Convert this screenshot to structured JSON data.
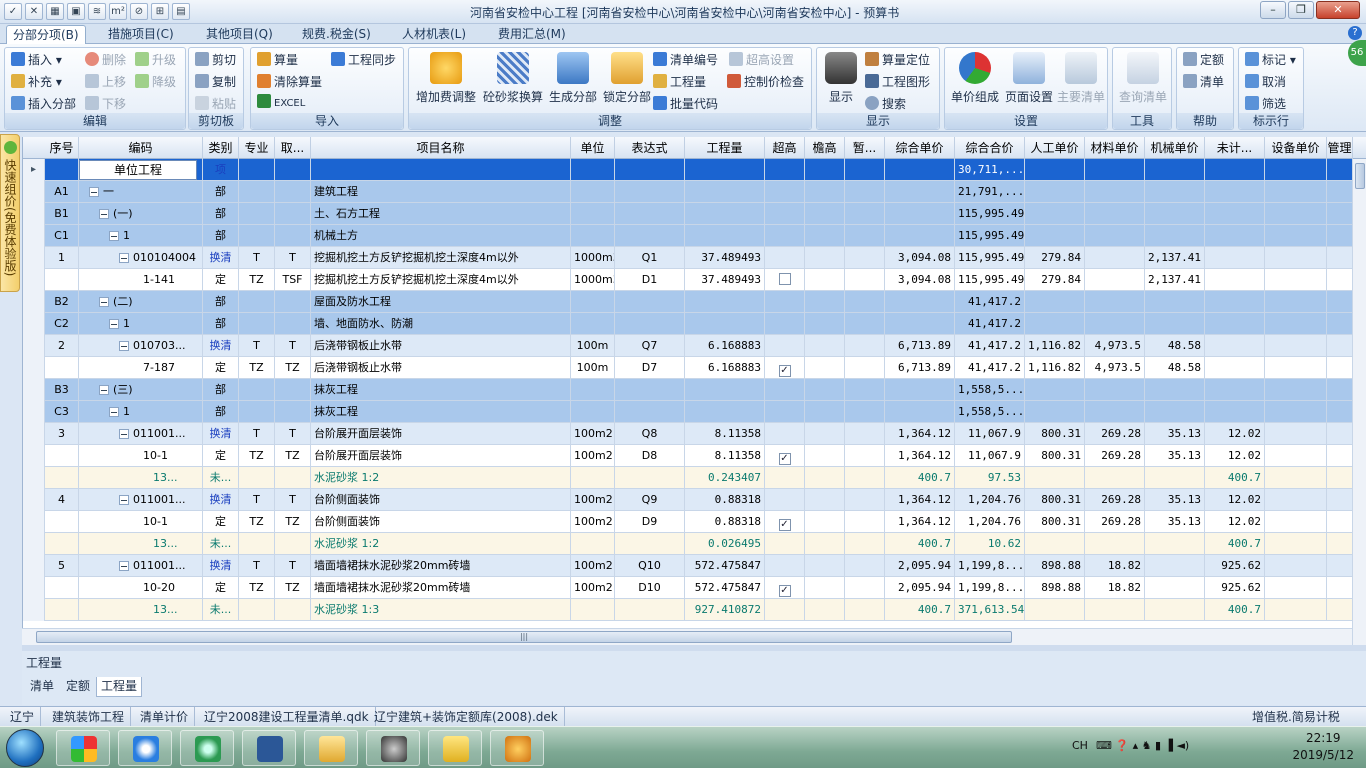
{
  "window": {
    "title": "河南省安检中心工程 [河南省安检中心\\河南省安检中心\\河南省安检中心] - 预算书"
  },
  "quick_access": [
    "✓",
    "✕",
    "▦",
    "▣",
    "≋",
    "m²",
    "⊘",
    "⊞",
    "▤"
  ],
  "tabs": [
    {
      "label": "分部分项(B)",
      "active": true
    },
    {
      "label": "措施项目(C)"
    },
    {
      "label": "其他项目(Q)"
    },
    {
      "label": "规费.税金(S)"
    },
    {
      "label": "人材机表(L)"
    },
    {
      "label": "费用汇总(M)"
    }
  ],
  "ribbon": {
    "groups": [
      {
        "name": "编辑",
        "small": [
          "插入",
          "删除",
          "升级",
          "补充",
          "上移",
          "降级",
          "插入分部",
          "下移"
        ]
      },
      {
        "name": "剪切板",
        "small": [
          "剪切",
          "复制",
          "粘贴"
        ]
      },
      {
        "name": "导入",
        "small": [
          "算量",
          "工程同步",
          "清除算量",
          "EXCEL"
        ]
      },
      {
        "name": "调整",
        "large": [
          "增加费调整",
          "砼砂浆换算",
          "生成分部",
          "锁定分部"
        ],
        "small": [
          "清单编号",
          "超高设置",
          "工程量",
          "控制价检查",
          "批量代码"
        ]
      },
      {
        "name": "显示",
        "large": [
          "显示"
        ],
        "small": [
          "算量定位",
          "工程图形",
          "搜索"
        ]
      },
      {
        "name": "设置",
        "large": [
          "单价组成",
          "页面设置",
          "主要清单"
        ]
      },
      {
        "name": "工具",
        "large": [
          "查询清单"
        ]
      },
      {
        "name": "帮助",
        "small": [
          "定额",
          "清单"
        ]
      },
      {
        "name": "标示行",
        "small": [
          "标记",
          "取消",
          "筛选"
        ]
      }
    ]
  },
  "side_tab": "快速组价(免费体验版)",
  "badge": "56",
  "columns": [
    "序号",
    "编码",
    "类别",
    "专业",
    "取...",
    "项目名称",
    "单位",
    "表达式",
    "工程量",
    "超高",
    "檐高",
    "暂...",
    "综合单价",
    "综合合价",
    "人工单价",
    "材料单价",
    "机械单价",
    "未计...",
    "设备单价",
    "管理"
  ],
  "rows": [
    {
      "type": "sel",
      "seq": "",
      "code": "单位工程",
      "cat": "项",
      "spec": "",
      "take": "",
      "name": "",
      "unit": "",
      "expr": "",
      "qty": "",
      "chk": "",
      "price": "",
      "total": "30,711,...",
      "labor": "",
      "mat": "",
      "mach": "",
      "unc": "",
      "level": 0
    },
    {
      "type": "blue",
      "seq": "A1",
      "code": "一",
      "cat": "部",
      "spec": "",
      "take": "",
      "name": "建筑工程",
      "unit": "",
      "expr": "",
      "qty": "",
      "chk": "",
      "price": "",
      "total": "21,791,...",
      "labor": "",
      "mat": "",
      "mach": "",
      "unc": "",
      "level": 1
    },
    {
      "type": "blue",
      "seq": "B1",
      "code": "(一)",
      "cat": "部",
      "spec": "",
      "take": "",
      "name": "土、石方工程",
      "unit": "",
      "expr": "",
      "qty": "",
      "chk": "",
      "price": "",
      "total": "115,995.49",
      "labor": "",
      "mat": "",
      "mach": "",
      "unc": "",
      "level": 2
    },
    {
      "type": "blue",
      "seq": "C1",
      "code": "1",
      "cat": "部",
      "spec": "",
      "take": "",
      "name": "机械土方",
      "unit": "",
      "expr": "",
      "qty": "",
      "chk": "",
      "price": "",
      "total": "115,995.49",
      "labor": "",
      "mat": "",
      "mach": "",
      "unc": "",
      "level": 3
    },
    {
      "type": "light",
      "seq": "1",
      "code": "010104004",
      "cat": "换清",
      "spec": "T",
      "take": "T",
      "name": "挖掘机挖土方反铲挖掘机挖土深度4m以外",
      "unit": "1000m3",
      "expr": "Q1",
      "qty": "37.489493",
      "chk": "",
      "price": "3,094.08",
      "total": "115,995.49",
      "labor": "279.84",
      "mat": "",
      "mach": "2,137.41",
      "unc": "",
      "level": 4
    },
    {
      "type": "white",
      "seq": "",
      "code": "1-141",
      "cat": "定",
      "spec": "TZ",
      "take": "TSF",
      "name": "挖掘机挖土方反铲挖掘机挖土深度4m以外",
      "unit": "1000m3",
      "expr": "D1",
      "qty": "37.489493",
      "chk": "☐",
      "price": "3,094.08",
      "total": "115,995.49",
      "labor": "279.84",
      "mat": "",
      "mach": "2,137.41",
      "unc": "",
      "level": 5
    },
    {
      "type": "blue",
      "seq": "B2",
      "code": "(二)",
      "cat": "部",
      "spec": "",
      "take": "",
      "name": "屋面及防水工程",
      "unit": "",
      "expr": "",
      "qty": "",
      "chk": "",
      "price": "",
      "total": "41,417.2",
      "labor": "",
      "mat": "",
      "mach": "",
      "unc": "",
      "level": 2
    },
    {
      "type": "blue",
      "seq": "C2",
      "code": "1",
      "cat": "部",
      "spec": "",
      "take": "",
      "name": "墙、地面防水、防潮",
      "unit": "",
      "expr": "",
      "qty": "",
      "chk": "",
      "price": "",
      "total": "41,417.2",
      "labor": "",
      "mat": "",
      "mach": "",
      "unc": "",
      "level": 3
    },
    {
      "type": "light",
      "seq": "2",
      "code": "010703...",
      "cat": "换清",
      "spec": "T",
      "take": "T",
      "name": "后浇带钢板止水带",
      "unit": "100m",
      "expr": "Q7",
      "qty": "6.168883",
      "chk": "",
      "price": "6,713.89",
      "total": "41,417.2",
      "labor": "1,116.82",
      "mat": "4,973.5",
      "mach": "48.58",
      "unc": "",
      "level": 4
    },
    {
      "type": "white",
      "seq": "",
      "code": "7-187",
      "cat": "定",
      "spec": "TZ",
      "take": "TZ",
      "name": "后浇带钢板止水带",
      "unit": "100m",
      "expr": "D7",
      "qty": "6.168883",
      "chk": "✓",
      "price": "6,713.89",
      "total": "41,417.2",
      "labor": "1,116.82",
      "mat": "4,973.5",
      "mach": "48.58",
      "unc": "",
      "level": 5
    },
    {
      "type": "blue",
      "seq": "B3",
      "code": "(三)",
      "cat": "部",
      "spec": "",
      "take": "",
      "name": "抹灰工程",
      "unit": "",
      "expr": "",
      "qty": "",
      "chk": "",
      "price": "",
      "total": "1,558,5...",
      "labor": "",
      "mat": "",
      "mach": "",
      "unc": "",
      "level": 2
    },
    {
      "type": "blue",
      "seq": "C3",
      "code": "1",
      "cat": "部",
      "spec": "",
      "take": "",
      "name": "抹灰工程",
      "unit": "",
      "expr": "",
      "qty": "",
      "chk": "",
      "price": "",
      "total": "1,558,5...",
      "labor": "",
      "mat": "",
      "mach": "",
      "unc": "",
      "level": 3
    },
    {
      "type": "light",
      "seq": "3",
      "code": "011001...",
      "cat": "换清",
      "spec": "T",
      "take": "T",
      "name": "台阶展开面层装饰",
      "unit": "100m2",
      "expr": "Q8",
      "qty": "8.11358",
      "chk": "",
      "price": "1,364.12",
      "total": "11,067.9",
      "labor": "800.31",
      "mat": "269.28",
      "mach": "35.13",
      "unc": "12.02",
      "level": 4
    },
    {
      "type": "white",
      "seq": "",
      "code": "10-1",
      "cat": "定",
      "spec": "TZ",
      "take": "TZ",
      "name": "台阶展开面层装饰",
      "unit": "100m2",
      "expr": "D8",
      "qty": "8.11358",
      "chk": "✓",
      "price": "1,364.12",
      "total": "11,067.9",
      "labor": "800.31",
      "mat": "269.28",
      "mach": "35.13",
      "unc": "12.02",
      "level": 5
    },
    {
      "type": "cream",
      "seq": "",
      "code": "13...",
      "cat": "未...",
      "spec": "",
      "take": "",
      "name": "水泥砂浆 1:2",
      "unit": "",
      "expr": "",
      "qty": "0.243407",
      "chk": "",
      "price": "400.7",
      "total": "97.53",
      "labor": "",
      "mat": "",
      "mach": "",
      "unc": "400.7",
      "level": 6
    },
    {
      "type": "light",
      "seq": "4",
      "code": "011001...",
      "cat": "换清",
      "spec": "T",
      "take": "T",
      "name": "台阶侧面装饰",
      "unit": "100m2",
      "expr": "Q9",
      "qty": "0.88318",
      "chk": "",
      "price": "1,364.12",
      "total": "1,204.76",
      "labor": "800.31",
      "mat": "269.28",
      "mach": "35.13",
      "unc": "12.02",
      "level": 4
    },
    {
      "type": "white",
      "seq": "",
      "code": "10-1",
      "cat": "定",
      "spec": "TZ",
      "take": "TZ",
      "name": "台阶侧面装饰",
      "unit": "100m2",
      "expr": "D9",
      "qty": "0.88318",
      "chk": "✓",
      "price": "1,364.12",
      "total": "1,204.76",
      "labor": "800.31",
      "mat": "269.28",
      "mach": "35.13",
      "unc": "12.02",
      "level": 5
    },
    {
      "type": "cream",
      "seq": "",
      "code": "13...",
      "cat": "未...",
      "spec": "",
      "take": "",
      "name": "水泥砂浆 1:2",
      "unit": "",
      "expr": "",
      "qty": "0.026495",
      "chk": "",
      "price": "400.7",
      "total": "10.62",
      "labor": "",
      "mat": "",
      "mach": "",
      "unc": "400.7",
      "level": 6
    },
    {
      "type": "light",
      "seq": "5",
      "code": "011001...",
      "cat": "换清",
      "spec": "T",
      "take": "T",
      "name": "墙面墙裙抹水泥砂浆20mm砖墙",
      "unit": "100m2",
      "expr": "Q10",
      "qty": "572.475847",
      "chk": "",
      "price": "2,095.94",
      "total": "1,199,8...",
      "labor": "898.88",
      "mat": "18.82",
      "mach": "",
      "unc": "925.62",
      "level": 4
    },
    {
      "type": "white",
      "seq": "",
      "code": "10-20",
      "cat": "定",
      "spec": "TZ",
      "take": "TZ",
      "name": "墙面墙裙抹水泥砂浆20mm砖墙",
      "unit": "100m2",
      "expr": "D10",
      "qty": "572.475847",
      "chk": "✓",
      "price": "2,095.94",
      "total": "1,199,8...",
      "labor": "898.88",
      "mat": "18.82",
      "mach": "",
      "unc": "925.62",
      "level": 5
    },
    {
      "type": "cream",
      "seq": "",
      "code": "13...",
      "cat": "未...",
      "spec": "",
      "take": "",
      "name": "水泥砂浆 1:3",
      "unit": "",
      "expr": "",
      "qty": "927.410872",
      "chk": "",
      "price": "400.7",
      "total": "371,613.54",
      "labor": "",
      "mat": "",
      "mach": "",
      "unc": "400.7",
      "level": 6
    }
  ],
  "bottom_panel": {
    "title": "工程量",
    "tabs": [
      "清单",
      "定额",
      "工程量"
    ]
  },
  "status": [
    "辽宁",
    "建筑装饰工程",
    "清单计价",
    "辽宁2008建设工程量清单.qdk",
    "辽宁建筑+装饰定额库(2008).dek",
    "增值税.简易计税"
  ],
  "tray": {
    "lang": "CH",
    "time": "22:19",
    "date": "2019/5/12"
  },
  "colors": {
    "blue": "#a9c8ec",
    "light": "#dde9f7",
    "white": "#ffffff",
    "cream": "#fbf6e6",
    "sel": "#1b64d1"
  }
}
